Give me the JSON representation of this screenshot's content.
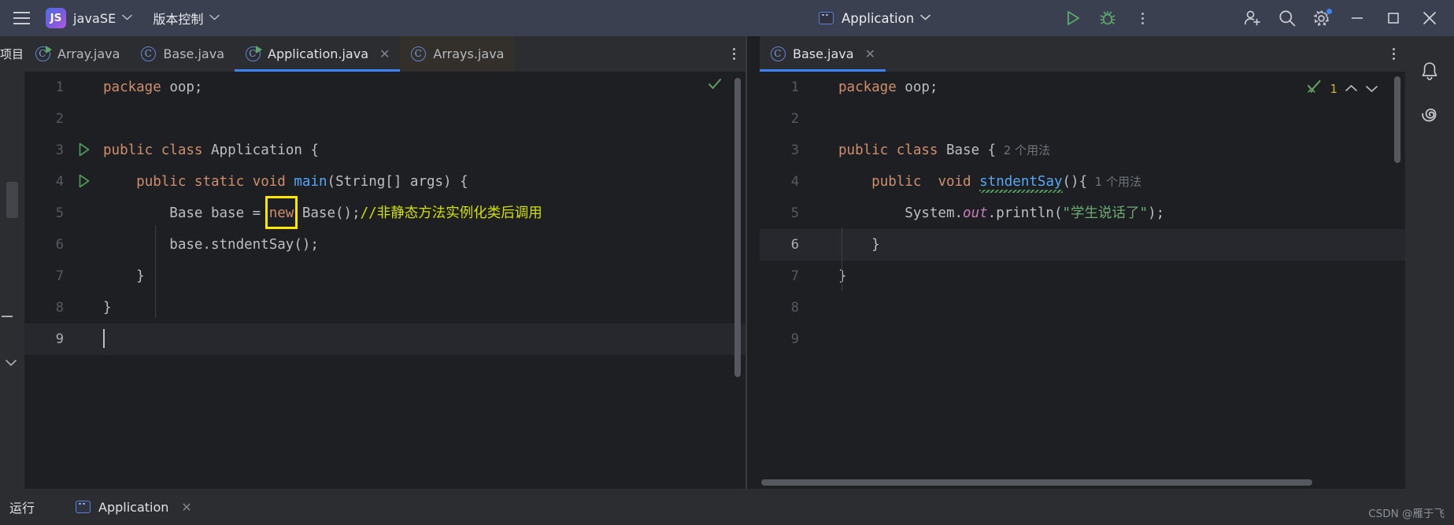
{
  "toolbar": {
    "menu_icon": "hamburger-icon",
    "project_badge": "JS",
    "project_name": "javaSE",
    "vcs_label": "版本控制",
    "run_config_name": "Application",
    "run_icon": "run-icon",
    "debug_icon": "debug-icon",
    "more_icon": "more-vertical-icon",
    "add_user_icon": "add-user-icon",
    "search_icon": "search-icon",
    "settings_icon": "settings-gear-icon",
    "minimize": "—",
    "maximize": "▢",
    "close": "✕"
  },
  "left_rail": {
    "label": "项目"
  },
  "tabs_left": [
    {
      "name": "Array.java",
      "icon": "java-class-runnable-icon",
      "active": false,
      "closable": false,
      "highlight": false
    },
    {
      "name": "Base.java",
      "icon": "java-class-icon",
      "active": false,
      "closable": false,
      "highlight": false
    },
    {
      "name": "Application.java",
      "icon": "java-class-runnable-icon",
      "active": true,
      "closable": true,
      "highlight": false
    },
    {
      "name": "Arrays.java",
      "icon": "java-class-icon",
      "active": false,
      "closable": false,
      "highlight": true
    }
  ],
  "tabs_right": [
    {
      "name": "Base.java",
      "icon": "java-class-icon",
      "active": true,
      "closable": true
    }
  ],
  "editor_left": {
    "file": "Application.java",
    "inspection_status": "ok-check",
    "current_line": 9,
    "lines": [
      {
        "n": 1,
        "runmark": false,
        "tokens": [
          {
            "t": "package",
            "c": "kw"
          },
          {
            "t": " ",
            "c": "id"
          },
          {
            "t": "oop",
            "c": "id"
          },
          {
            "t": ";",
            "c": "id"
          }
        ]
      },
      {
        "n": 2,
        "runmark": false,
        "tokens": []
      },
      {
        "n": 3,
        "runmark": true,
        "tokens": [
          {
            "t": "public",
            "c": "kw"
          },
          {
            "t": " ",
            "c": "id"
          },
          {
            "t": "class",
            "c": "kw"
          },
          {
            "t": " ",
            "c": "id"
          },
          {
            "t": "Application",
            "c": "id"
          },
          {
            "t": " {",
            "c": "id"
          }
        ]
      },
      {
        "n": 4,
        "runmark": true,
        "tokens": [
          {
            "t": "    ",
            "c": "id"
          },
          {
            "t": "public",
            "c": "kw"
          },
          {
            "t": " ",
            "c": "id"
          },
          {
            "t": "static",
            "c": "kw"
          },
          {
            "t": " ",
            "c": "id"
          },
          {
            "t": "void",
            "c": "kw"
          },
          {
            "t": " ",
            "c": "id"
          },
          {
            "t": "main",
            "c": "fn"
          },
          {
            "t": "(String[] args) {",
            "c": "id"
          }
        ]
      },
      {
        "n": 5,
        "runmark": false,
        "tokens": [
          {
            "t": "        Base base = ",
            "c": "id"
          },
          {
            "t": "new",
            "c": "kw"
          },
          {
            "t": " Base();",
            "c": "id"
          },
          {
            "t": "//非静态方法实例化类后调用",
            "c": "cmt"
          }
        ]
      },
      {
        "n": 6,
        "runmark": false,
        "tokens": [
          {
            "t": "        base.stndentSay();",
            "c": "id"
          }
        ]
      },
      {
        "n": 7,
        "runmark": false,
        "tokens": [
          {
            "t": "    }",
            "c": "id"
          }
        ]
      },
      {
        "n": 8,
        "runmark": false,
        "tokens": [
          {
            "t": "}",
            "c": "id"
          }
        ]
      },
      {
        "n": 9,
        "runmark": false,
        "tokens": []
      }
    ],
    "annotation": {
      "shape": "rectangle",
      "color": "#ffe800",
      "target_text": "new"
    }
  },
  "editor_right": {
    "file": "Base.java",
    "inspection_count": "1",
    "inspection_icon": "check-with-squiggle-icon",
    "prev_icon": "chevron-up-icon",
    "next_icon": "chevron-down-icon",
    "current_line": 6,
    "lines": [
      {
        "n": 1,
        "tokens": [
          {
            "t": "package",
            "c": "kw"
          },
          {
            "t": " oop;",
            "c": "id"
          }
        ]
      },
      {
        "n": 2,
        "tokens": []
      },
      {
        "n": 3,
        "tokens": [
          {
            "t": "public",
            "c": "kw"
          },
          {
            "t": " ",
            "c": "id"
          },
          {
            "t": "class",
            "c": "kw"
          },
          {
            "t": " Base {",
            "c": "id"
          },
          {
            "t": "  2 个用法",
            "c": "hint"
          }
        ]
      },
      {
        "n": 4,
        "tokens": [
          {
            "t": "    ",
            "c": "id"
          },
          {
            "t": "public",
            "c": "kw"
          },
          {
            "t": "  ",
            "c": "id"
          },
          {
            "t": "void",
            "c": "kw"
          },
          {
            "t": " ",
            "c": "id"
          },
          {
            "t": "stndentSay",
            "c": "fn typo"
          },
          {
            "t": "(){",
            "c": "id"
          },
          {
            "t": "  1 个用法",
            "c": "hint"
          }
        ]
      },
      {
        "n": 5,
        "tokens": [
          {
            "t": "        System.",
            "c": "id"
          },
          {
            "t": "out",
            "c": "fld"
          },
          {
            "t": ".println(",
            "c": "id"
          },
          {
            "t": "\"学生说话了\"",
            "c": "str"
          },
          {
            "t": ");",
            "c": "id"
          }
        ]
      },
      {
        "n": 6,
        "tokens": [
          {
            "t": "    }",
            "c": "id"
          }
        ]
      },
      {
        "n": 7,
        "tokens": [
          {
            "t": "}",
            "c": "id"
          }
        ]
      },
      {
        "n": 8,
        "tokens": []
      },
      {
        "n": 9,
        "tokens": []
      }
    ]
  },
  "right_rail": {
    "notification_icon": "bell-icon",
    "assistant_icon": "ai-assistant-icon"
  },
  "bottom": {
    "title": "运行",
    "tab_icon": "run-config-icon",
    "tab_name": "Application",
    "close_icon": "✕",
    "watermark": "CSDN @雁于飞"
  },
  "colors": {
    "accent_blue": "#3d83f5",
    "keyword_orange": "#cf8e6d",
    "string_green": "#6aab73",
    "comment_yellow": "#d3e000",
    "annotation_yellow": "#ffe800",
    "editor_bg": "#1e1f22",
    "chrome_bg": "#2b2d30",
    "toolbar_bg": "#3b4050"
  }
}
